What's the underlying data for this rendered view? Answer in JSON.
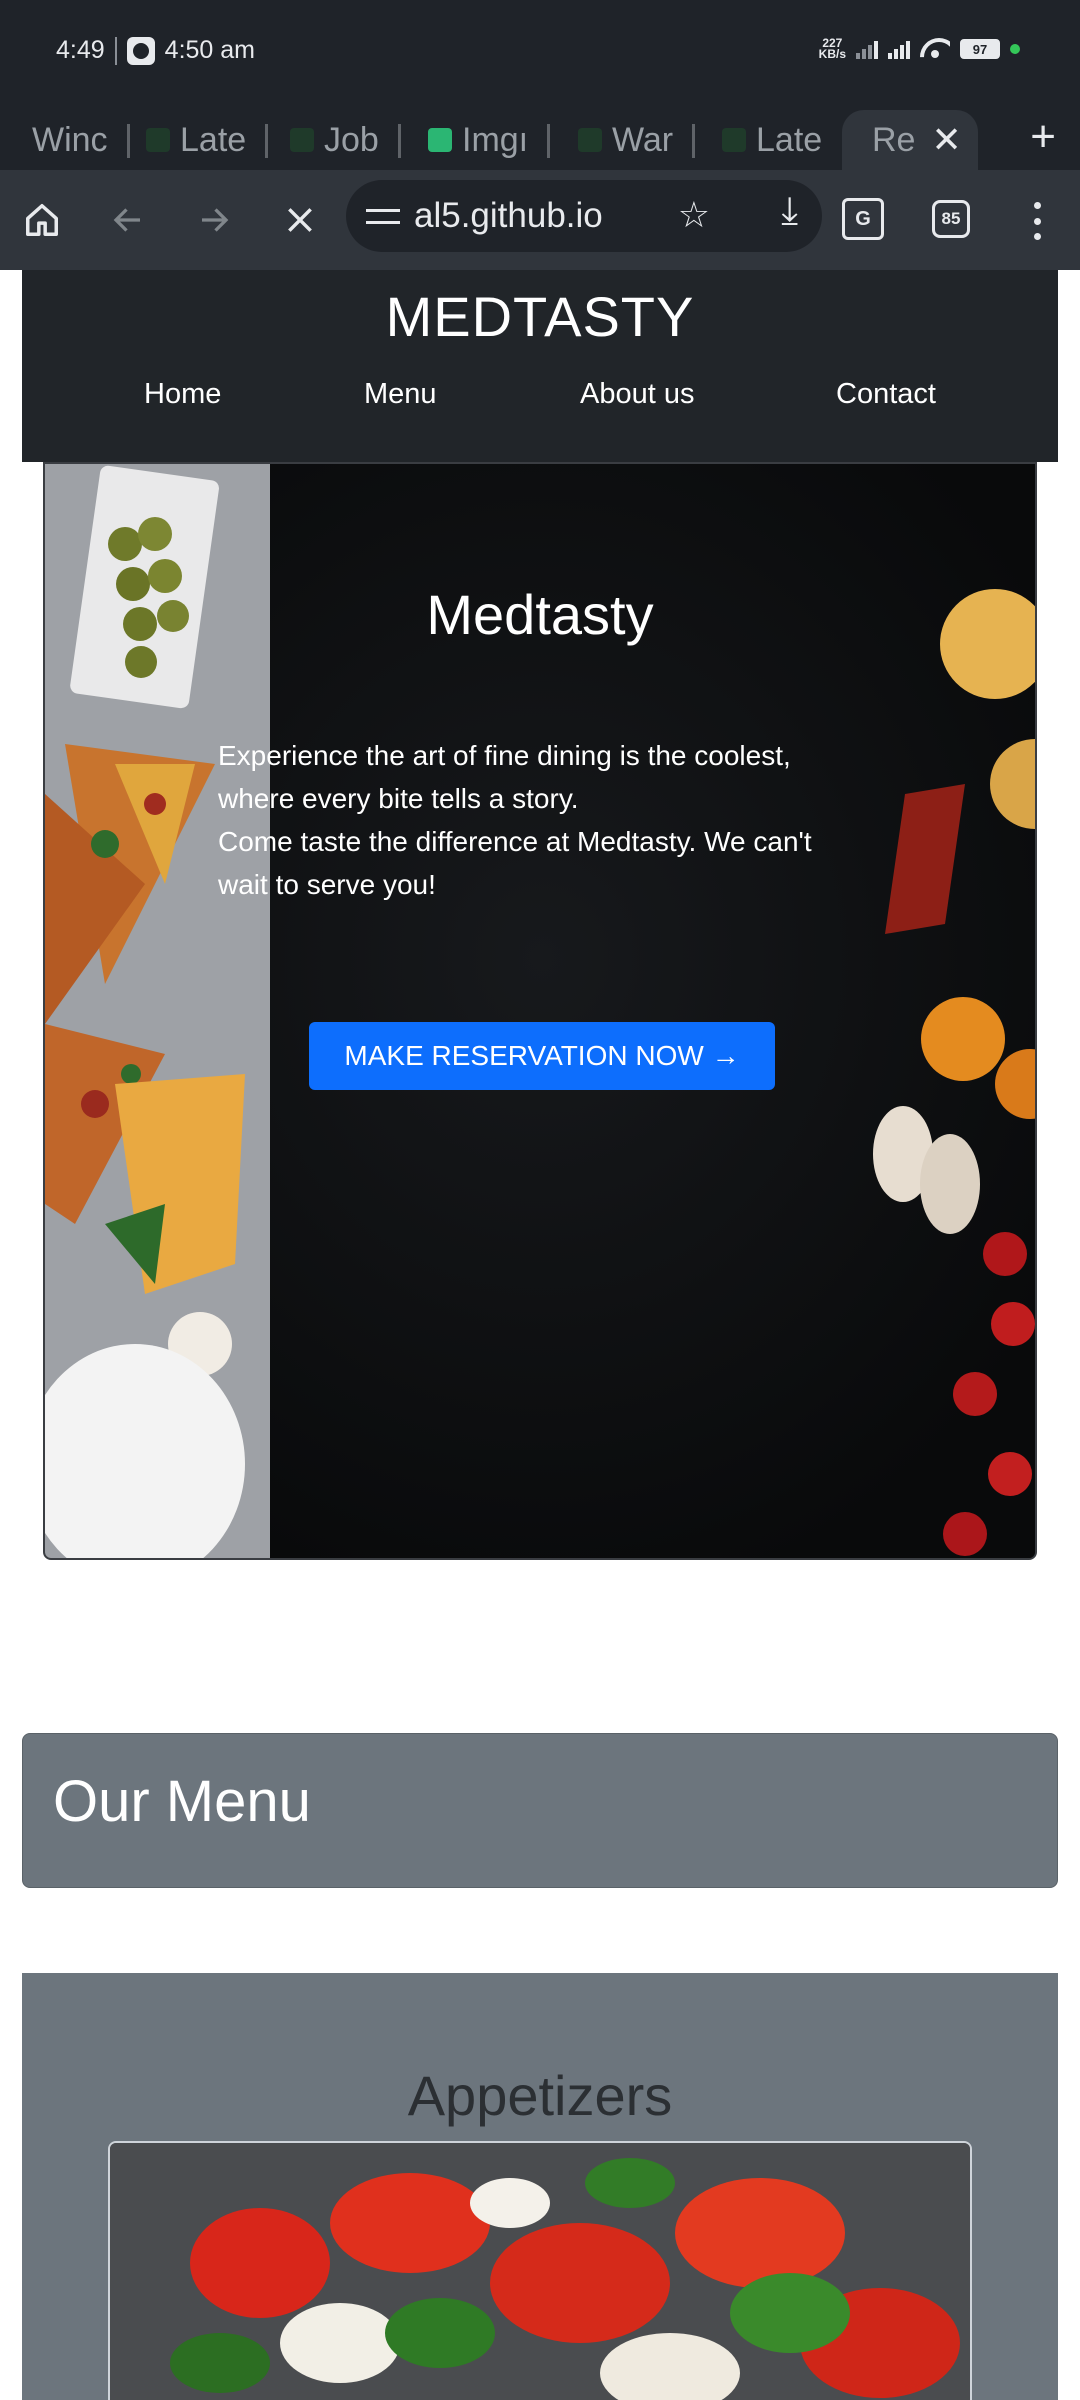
{
  "status_bar": {
    "time": "4:49",
    "clock_text": "4:50 am",
    "net_speed_value": "227",
    "net_speed_unit": "KB/s",
    "battery": "97"
  },
  "tabs": [
    {
      "label": "Winc"
    },
    {
      "label": "Late"
    },
    {
      "label": "Job"
    },
    {
      "label": "Imgı"
    },
    {
      "label": "War"
    },
    {
      "label": "Late"
    },
    {
      "label": "Re"
    }
  ],
  "toolbar": {
    "url": "al5.github.io",
    "tab_count": "85",
    "translate_glyph": "G"
  },
  "site": {
    "brand": "MEDTASTY",
    "nav": [
      "Home",
      "Menu",
      "About us",
      "Contact"
    ]
  },
  "hero": {
    "title": "Medtasty",
    "text_line1": "Experience the art of fine dining is the coolest, where every bite tells a story.",
    "text_line2": "Come taste the difference at Medtasty. We can't wait to serve you!",
    "button": "MAKE RESERVATION NOW →"
  },
  "menu_section": {
    "heading": "Our Menu",
    "category": "Appetizers"
  },
  "colors": {
    "chrome_dark": "#1f2329",
    "toolbar": "#30353c",
    "header_bg": "#212529",
    "primary": "#0d6efd",
    "secondary": "#6c757d"
  }
}
